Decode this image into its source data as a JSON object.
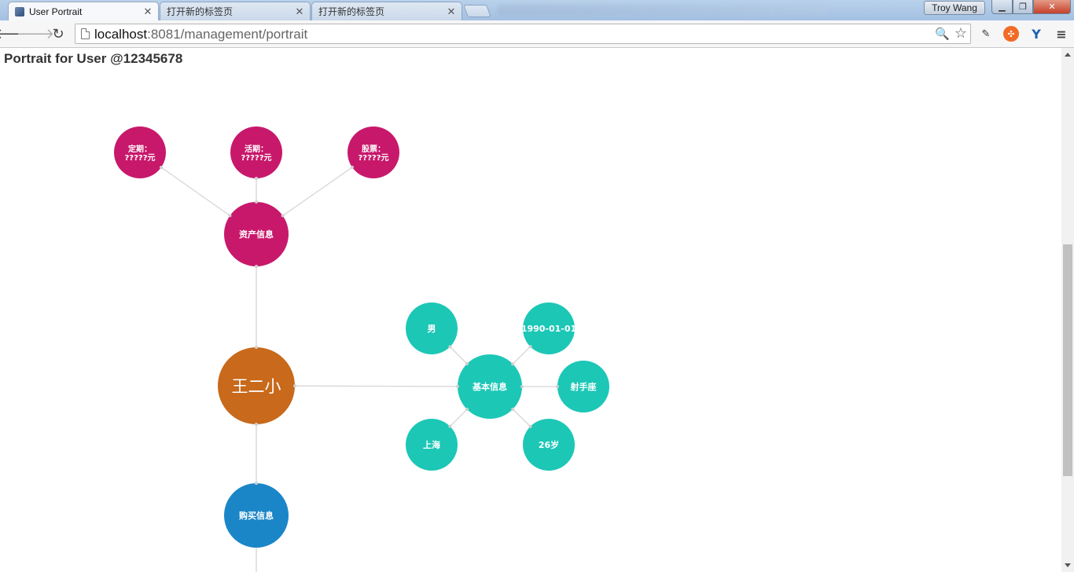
{
  "browser": {
    "tabs": [
      {
        "label": "User Portrait",
        "active": true
      },
      {
        "label": "打开新的标签页",
        "active": false
      },
      {
        "label": "打开新的标签页",
        "active": false
      }
    ],
    "profile_name": "Troy Wang",
    "url_host": "localhost",
    "url_rest": ":8081/management/portrait"
  },
  "page": {
    "title": "Portrait for User @12345678"
  },
  "graph": {
    "colors": {
      "asset": "#c8186b",
      "center": "#c8691b",
      "basic": "#1cc7b6",
      "purchase": "#1a86c8"
    },
    "nodes": [
      {
        "id": "center",
        "label": "王二小",
        "group": "center"
      },
      {
        "id": "asset",
        "label": "资产信息",
        "group": "asset"
      },
      {
        "id": "fixed",
        "label": "定期：",
        "sub": "?????元",
        "group": "asset"
      },
      {
        "id": "current",
        "label": "活期：",
        "sub": "?????元",
        "group": "asset"
      },
      {
        "id": "stock",
        "label": "股票：",
        "sub": "?????元",
        "group": "asset"
      },
      {
        "id": "basic",
        "label": "基本信息",
        "group": "basic"
      },
      {
        "id": "gender",
        "label": "男",
        "group": "basic"
      },
      {
        "id": "birthday",
        "label": "1990-01-01",
        "group": "basic"
      },
      {
        "id": "zodiac",
        "label": "射手座",
        "group": "basic"
      },
      {
        "id": "city",
        "label": "上海",
        "group": "basic"
      },
      {
        "id": "age",
        "label": "26岁",
        "group": "basic"
      },
      {
        "id": "purchase",
        "label": "购买信息",
        "group": "purchase"
      }
    ],
    "edges": [
      [
        "center",
        "asset"
      ],
      [
        "center",
        "basic"
      ],
      [
        "center",
        "purchase"
      ],
      [
        "asset",
        "fixed"
      ],
      [
        "asset",
        "current"
      ],
      [
        "asset",
        "stock"
      ],
      [
        "basic",
        "gender"
      ],
      [
        "basic",
        "birthday"
      ],
      [
        "basic",
        "zodiac"
      ],
      [
        "basic",
        "city"
      ],
      [
        "basic",
        "age"
      ]
    ]
  }
}
